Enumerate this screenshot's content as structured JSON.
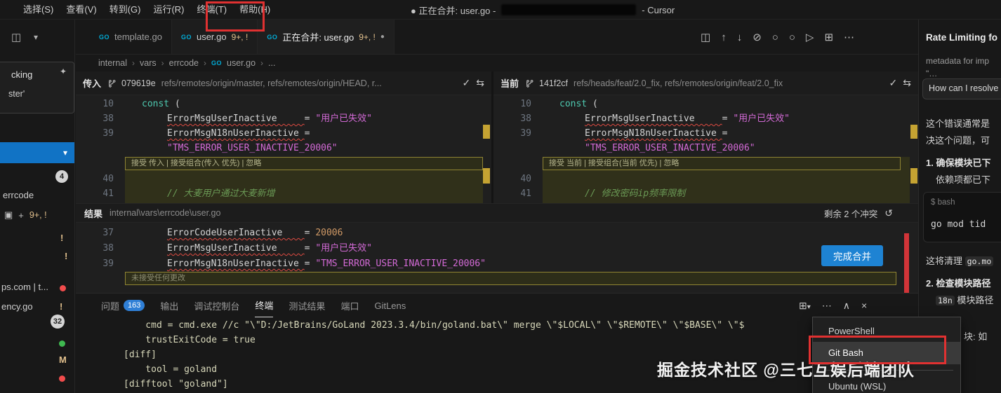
{
  "colors": {
    "accent_blue": "#1e83d3",
    "annotation_red": "#e03131",
    "conflict_yellow": "#c5a332",
    "error_red": "#d13438",
    "string_magenta": "#d36ad6",
    "keyword_teal": "#4ec9b0",
    "comment_green": "#6a9955",
    "number_orange": "#d19a66",
    "badge_blue": "#2f7fd6",
    "selection_blue": "#1173c5"
  },
  "icons": {
    "go": "GO",
    "layout": "◫",
    "chevron_down": "▾",
    "split_diff": "◫",
    "arrow_up": "↑",
    "arrow_down": "↓",
    "discard": "⊘",
    "circle_prev": "○",
    "circle_next": "○",
    "run": "▷",
    "grid": "⊞",
    "more": "⋯",
    "check": "✓",
    "compare": "⇆",
    "undo": "↺",
    "close": "×",
    "chevron_up": "∧",
    "sparkle": "✦",
    "plus": "+",
    "copy": "▣",
    "crumb_sep": "›",
    "dirty_dot": "●"
  },
  "menubar": {
    "items": [
      "选择(S)",
      "查看(V)",
      "转到(G)",
      "运行(R)",
      "终端(T)",
      "帮助(H)"
    ],
    "title": "● 正在合并: user.go -",
    "title_suffix": "- Cursor"
  },
  "tabs": {
    "tab1": {
      "label": "template.go"
    },
    "tab2": {
      "label": "user.go",
      "badge": "9+, !"
    },
    "tab3": {
      "label": "正在合并: user.go",
      "badge": "9+, !"
    }
  },
  "breadcrumb": {
    "items": [
      "internal",
      "vars",
      "errcode",
      "user.go",
      "..."
    ]
  },
  "merge": {
    "incoming": {
      "label": "传入",
      "commit": "079619e",
      "refs": "refs/remotes/origin/master, refs/remotes/origin/HEAD, r...",
      "actions": "接受 传入 | 接受组合(传入 优先) | 忽略",
      "comment": "// 大麦用户通过大麦新增"
    },
    "current": {
      "label": "当前",
      "commit": "141f2cf",
      "refs": "refs/heads/feat/2.0_fix, refs/remotes/origin/feat/2.0_fix",
      "actions": "接受 当前 | 接受组合(当前 优先) | 忽略",
      "comment": "// 修改密码ip频率限制"
    },
    "result": {
      "label": "结果",
      "path": "internal\\vars\\errcode\\user.go",
      "remaining": "剩余 2 个冲突",
      "actions": "未接受任何更改",
      "button": "完成合并"
    },
    "code": {
      "l10": {
        "num": "10",
        "kw": "const",
        "rest": " ("
      },
      "l38": {
        "num": "38",
        "ident": "ErrorMsgUserInactive     ",
        "eq": "= ",
        "str": "\"用户已失效\""
      },
      "l39": {
        "num": "39",
        "ident": "ErrorMsgN18nUserInactive ",
        "eq": "=",
        "wrap": "\"TMS_ERROR_USER_INACTIVE_20006\""
      },
      "l40": {
        "num": "40"
      },
      "l41": {
        "num": "41"
      },
      "r37": {
        "num": "37",
        "ident": "ErrorCodeUserInactive    ",
        "eq": "= ",
        "val": "20006"
      },
      "r38": {
        "num": "38",
        "ident": "ErrorMsgUserInactive     ",
        "eq": "= ",
        "str": "\"用户已失效\""
      },
      "r39": {
        "num": "39",
        "ident": "ErrorMsgN18nUserInactive ",
        "eq": "= ",
        "str": "\"TMS_ERROR_USER_INACTIVE_20006\""
      }
    }
  },
  "panel": {
    "tabs": [
      "问题",
      "输出",
      "调试控制台",
      "终端",
      "测试结果",
      "端口",
      "GitLens"
    ],
    "problems_badge": "163",
    "terminal_lines": [
      "    cmd = cmd.exe //c \"\\\"D:/JetBrains/GoLand 2023.3.4/bin/goland.bat\\\" merge \\\"$LOCAL\\\" \\\"$REMOTE\\\" \\\"$BASE\\\" \\\"$",
      "    trustExitCode = true",
      "[diff]",
      "    tool = goland",
      "[difftool \"goland\"]"
    ],
    "profile_menu": [
      "PowerShell",
      "Git Bash",
      "Ubuntu (WSL)"
    ]
  },
  "chat": {
    "title": "Rate Limiting fo",
    "quote": "metadata for imp",
    "quote2": "\"…",
    "user_msg": "How can I resolve",
    "p1a": "这个错误通常是",
    "p1b": "决这个问题，可",
    "l1a": "1. 确保模块已下",
    "l1b": "依赖项都已下",
    "code_prompt": "$",
    "code_lang": "bash",
    "code_line": "go mod tid",
    "p2a": "这将清理 ",
    "p2b": "go.mo",
    "l2a": "2. 检查模块路径",
    "l2b_code": "18n",
    "l2b_text": " 模块路径",
    "p3": "块: 如"
  },
  "sidebar": {
    "tip1": "cking",
    "tip2": "ster'",
    "badge1": "4",
    "errcode": "errcode",
    "scm_badge": "9+, !",
    "warn1": "!",
    "warn2": "!",
    "warn3": "!",
    "ps": "ps.com | t...",
    "ency": "ency.go",
    "badge2": "32",
    "m": "M"
  },
  "watermark": "掘金技术社区 @三七互娱后端团队"
}
